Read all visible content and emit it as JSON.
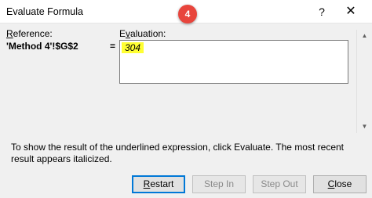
{
  "window": {
    "title": "Evaluate Formula",
    "help_label": "?",
    "close_label": "✕"
  },
  "annotation": {
    "marker_number": "4",
    "marker_color": "#e8453c"
  },
  "reference": {
    "label_first": "R",
    "label_rest": "eference:",
    "value": "'Method 4'!$G$2",
    "equals": "="
  },
  "evaluation": {
    "label_first": "E",
    "label_accel": "v",
    "label_rest": "aluation:",
    "value": "304",
    "highlight_color": "#ffff33"
  },
  "info_text": "To show the result of the underlined expression, click Evaluate.  The most recent result appears italicized.",
  "buttons": {
    "restart": {
      "accel": "R",
      "rest": "estart"
    },
    "step_in": "Step In",
    "step_out": "Step Out",
    "close": {
      "accel": "C",
      "rest": "lose"
    }
  },
  "scrollbar": {
    "up": "▲",
    "down": "▼"
  }
}
